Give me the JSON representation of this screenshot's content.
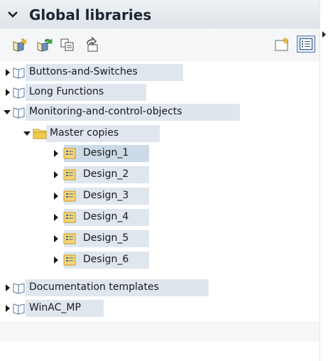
{
  "header": {
    "title": "Global libraries"
  },
  "toolbar": {
    "buttons": [
      "new-library-icon",
      "update-library-icon",
      "copy-types-icon",
      "open-library-icon",
      "new-folder-icon",
      "details-view-icon"
    ]
  },
  "tree": {
    "items": [
      {
        "label": "Buttons-and-Switches",
        "type": "library",
        "expanded": false
      },
      {
        "label": "Long Functions",
        "type": "library",
        "expanded": false
      },
      {
        "label": "Monitoring-and-control-objects",
        "type": "library",
        "expanded": true
      },
      {
        "label": "Master copies",
        "type": "folder",
        "expanded": true
      },
      {
        "label": "Design_1",
        "type": "master-copy",
        "expanded": false,
        "selected": true
      },
      {
        "label": "Design_2",
        "type": "master-copy",
        "expanded": false
      },
      {
        "label": "Design_3",
        "type": "master-copy",
        "expanded": false
      },
      {
        "label": "Design_4",
        "type": "master-copy",
        "expanded": false
      },
      {
        "label": "Design_5",
        "type": "master-copy",
        "expanded": false
      },
      {
        "label": "Design_6",
        "type": "master-copy",
        "expanded": false
      },
      {
        "label": "Documentation templates",
        "type": "library",
        "expanded": false
      },
      {
        "label": "WinAC_MP",
        "type": "library",
        "expanded": false
      }
    ]
  },
  "colors": {
    "header_bg": "#e6ebef",
    "row_highlight": "#dfe6ee",
    "selected_row": "#cddae7",
    "library_icon": "#6d8fb3",
    "folder_icon": "#e8c24a"
  }
}
